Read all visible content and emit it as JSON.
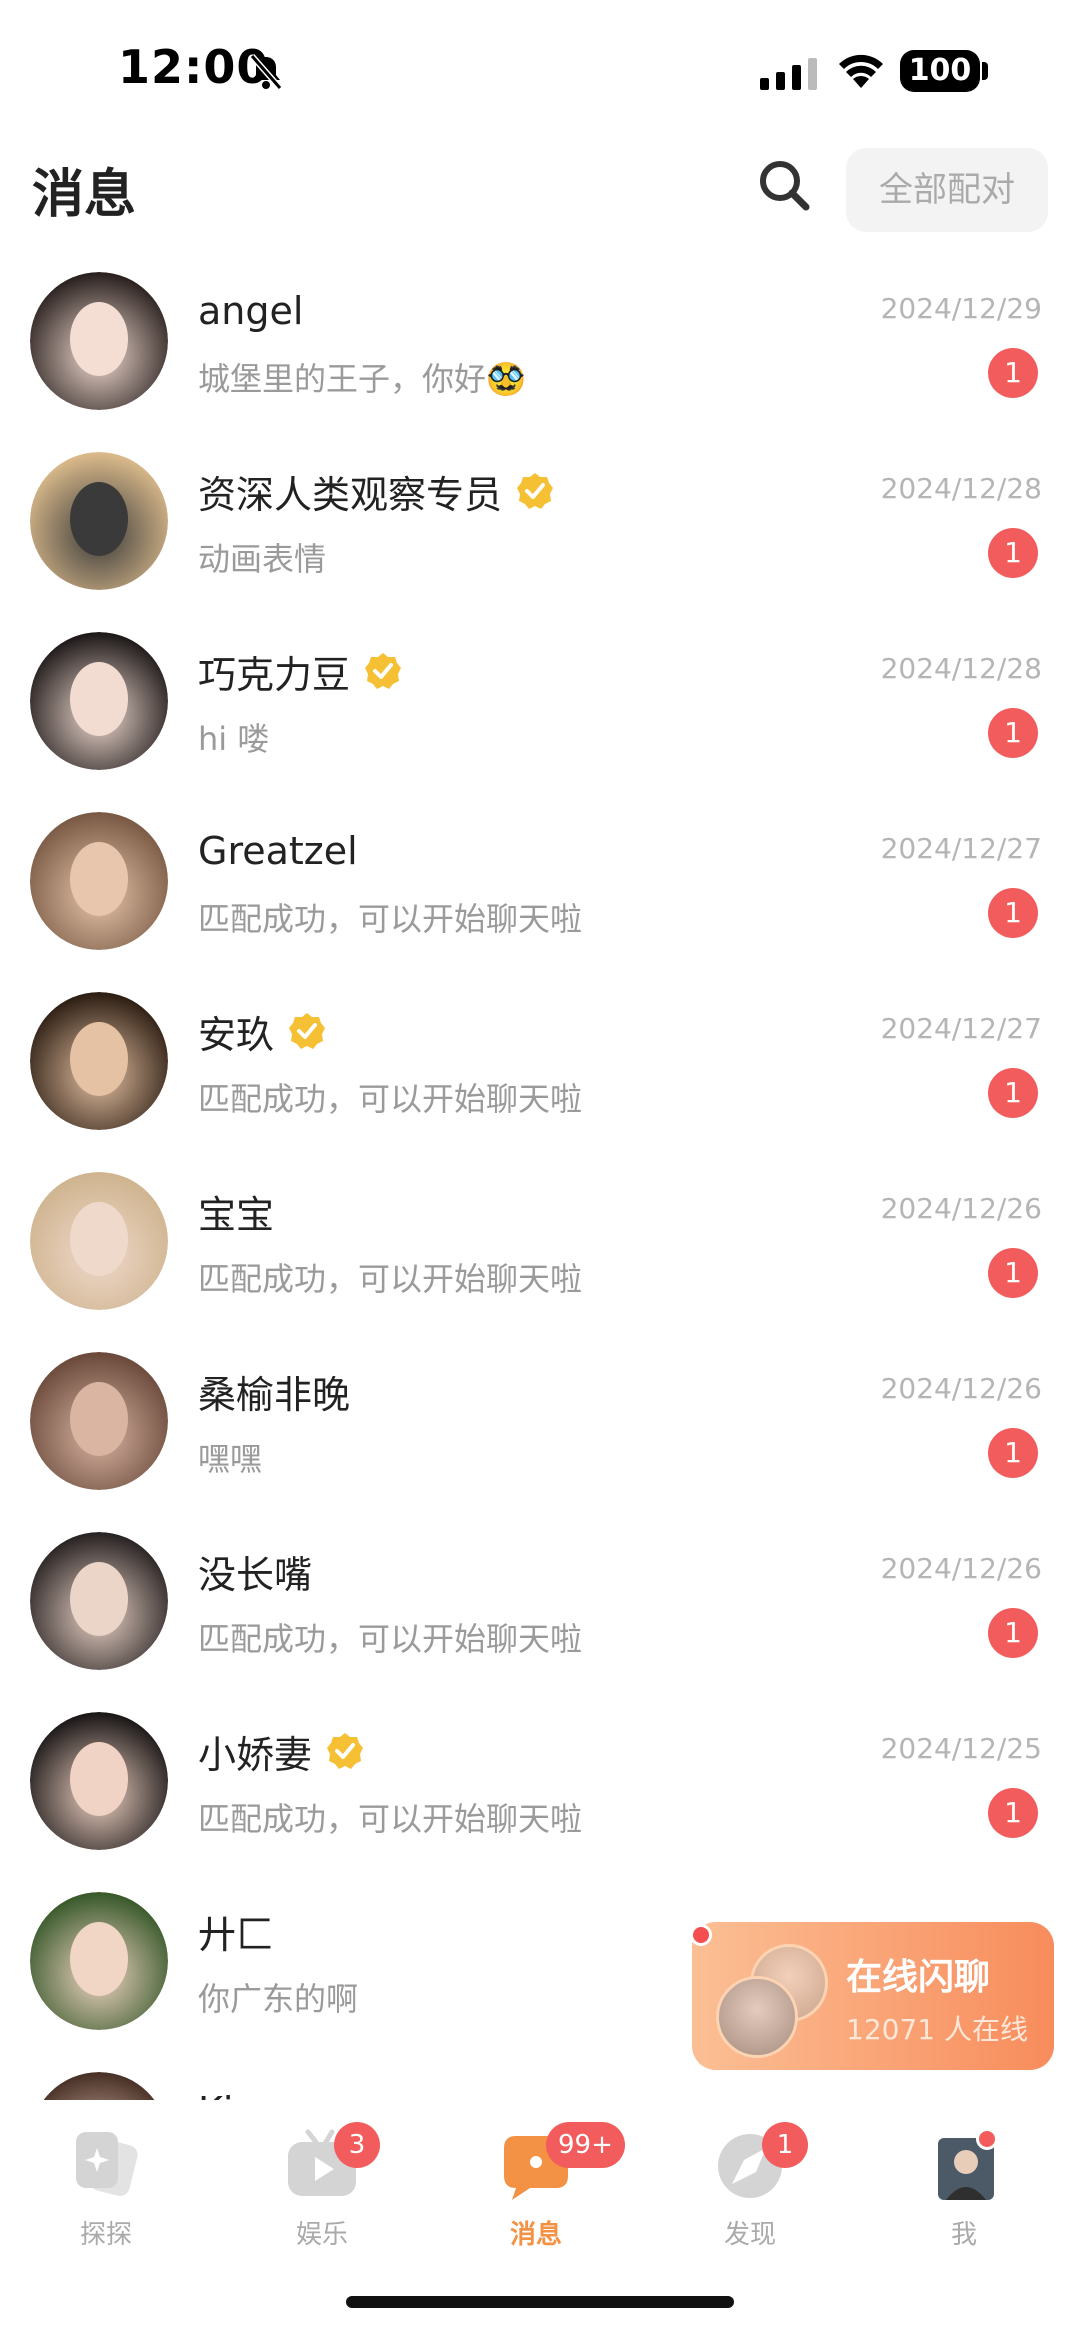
{
  "status_bar": {
    "time": "12:00",
    "battery": "100"
  },
  "header": {
    "title": "消息",
    "match_all_label": "全部配对"
  },
  "conversations": [
    {
      "name": "angel",
      "verified": false,
      "preview": "城堡里的王子，你好🥸",
      "date": "2024/12/29",
      "unread": "1",
      "hair": "#2b2220",
      "face": "#f4ddd3"
    },
    {
      "name": "资深人类观察专员",
      "verified": true,
      "preview": "动画表情",
      "date": "2024/12/28",
      "unread": "1",
      "hair": "#d9b98a",
      "face": "#3a3a3a"
    },
    {
      "name": "巧克力豆",
      "verified": true,
      "preview": "hi 喽",
      "date": "2024/12/28",
      "unread": "1",
      "hair": "#1f1a1a",
      "face": "#f2dcd2"
    },
    {
      "name": "Greatzel",
      "verified": false,
      "preview": "匹配成功，可以开始聊天啦",
      "date": "2024/12/27",
      "unread": "1",
      "hair": "#7a5a44",
      "face": "#e8c6ad"
    },
    {
      "name": "安玖",
      "verified": true,
      "preview": "匹配成功，可以开始聊天啦",
      "date": "2024/12/27",
      "unread": "1",
      "hair": "#2e1f14",
      "face": "#e6c2a4"
    },
    {
      "name": "宝宝",
      "verified": false,
      "preview": "匹配成功，可以开始聊天啦",
      "date": "2024/12/26",
      "unread": "1",
      "hair": "#cfb48f",
      "face": "#efd9cb"
    },
    {
      "name": "桑榆非晚",
      "verified": false,
      "preview": "嘿嘿",
      "date": "2024/12/26",
      "unread": "1",
      "hair": "#6b4a3c",
      "face": "#d9b5a2"
    },
    {
      "name": "没长嘴",
      "verified": false,
      "preview": "匹配成功，可以开始聊天啦",
      "date": "2024/12/26",
      "unread": "1",
      "hair": "#2a2424",
      "face": "#ebd4c8"
    },
    {
      "name": "小娇妻",
      "verified": true,
      "preview": "匹配成功，可以开始聊天啦",
      "date": "2024/12/25",
      "unread": "1",
      "hair": "#1c1818",
      "face": "#f0d3c4"
    },
    {
      "name": "廾匚",
      "verified": false,
      "preview": "你广东的啊",
      "date": "",
      "unread": "",
      "hair": "#3a5a2c",
      "face": "#f1d6c5"
    },
    {
      "name": "Ki...",
      "verified": false,
      "preview": "",
      "date": "",
      "unread": "",
      "hair": "#4a3228",
      "face": "#e7c6b4"
    }
  ],
  "flash_chat": {
    "title": "在线闪聊",
    "subtitle": "12071 人在线"
  },
  "tabs": [
    {
      "label": "探探",
      "badge": ""
    },
    {
      "label": "娱乐",
      "badge": "3"
    },
    {
      "label": "消息",
      "badge": "99+"
    },
    {
      "label": "发现",
      "badge": "1"
    },
    {
      "label": "我",
      "badge": ""
    }
  ],
  "colors": {
    "accent": "#f39244",
    "badge": "#f25c5c",
    "verified": "#f6c034",
    "muted": "#9a9a9a"
  }
}
